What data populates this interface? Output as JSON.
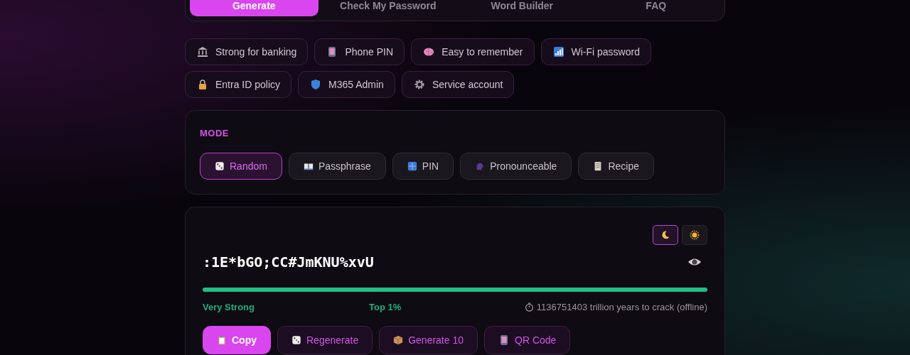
{
  "tabs": [
    {
      "label": "Generate",
      "selected": true
    },
    {
      "label": "Check My Password",
      "selected": false
    },
    {
      "label": "Word Builder",
      "selected": false
    },
    {
      "label": "FAQ",
      "selected": false
    }
  ],
  "presets": [
    {
      "label": "Strong for banking"
    },
    {
      "label": "Phone PIN"
    },
    {
      "label": "Easy to remember"
    },
    {
      "label": "Wi-Fi password"
    },
    {
      "label": "Entra ID policy"
    },
    {
      "label": "M365 Admin"
    },
    {
      "label": "Service account"
    }
  ],
  "mode": {
    "heading": "MODE",
    "options": [
      {
        "label": "Random",
        "selected": true
      },
      {
        "label": "Passphrase",
        "selected": false
      },
      {
        "label": "PIN",
        "selected": false
      },
      {
        "label": "Pronounceable",
        "selected": false
      },
      {
        "label": "Recipe",
        "selected": false
      }
    ]
  },
  "result": {
    "theme": [
      {
        "kind": "dark",
        "selected": true
      },
      {
        "kind": "light",
        "selected": false
      }
    ],
    "password": ":1E*bGO;CC#JmKNU%xvU",
    "strength": {
      "level": 1,
      "label": "Very Strong",
      "rank": "Top 1%",
      "crack_time": "1136751403 trillion years to crack (offline)"
    },
    "actions": [
      {
        "label": "Copy",
        "primary": true
      },
      {
        "label": "Regenerate",
        "primary": false
      },
      {
        "label": "Generate 10",
        "primary": false
      },
      {
        "label": "QR Code",
        "primary": false
      }
    ]
  }
}
